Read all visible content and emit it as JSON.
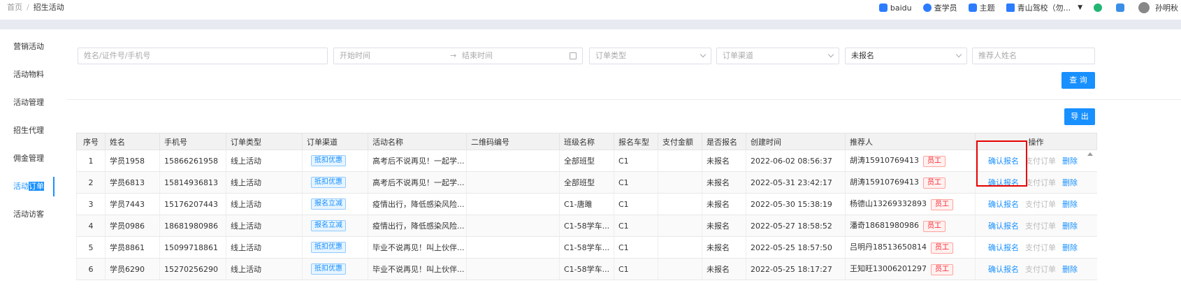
{
  "breadcrumb": {
    "home": "首页",
    "separator": "/",
    "current": "招生活动"
  },
  "topbar": {
    "items": [
      {
        "label": "baidu",
        "icon": "baidu-icon",
        "color": "#2b7cff"
      },
      {
        "label": "查学员",
        "icon": "search-student-icon",
        "color": "#2b7cff"
      },
      {
        "label": "主题",
        "icon": "shirt-icon",
        "color": "#2b7cff"
      },
      {
        "label": "青山驾校（勿...",
        "icon": "school-icon",
        "color": "#2b7cff"
      }
    ],
    "user": "孙明秋"
  },
  "sidebar": {
    "items": [
      {
        "label": "营销活动"
      },
      {
        "label": "活动物料"
      },
      {
        "label": "活动管理"
      },
      {
        "label": "招生代理"
      },
      {
        "label": "佣金管理"
      },
      {
        "label_a": "活动",
        "label_b": "订单",
        "active": true
      },
      {
        "label": "活动访客"
      }
    ]
  },
  "filters": {
    "keyword_placeholder": "姓名/证件号/手机号",
    "start_placeholder": "开始时间",
    "arrow": "→",
    "end_placeholder": "结束时间",
    "order_type_placeholder": "订单类型",
    "order_channel_placeholder": "订单渠道",
    "enroll_status_value": "未报名",
    "referrer_placeholder": "推荐人姓名"
  },
  "buttons": {
    "query": "查 询",
    "export": "导 出"
  },
  "table": {
    "headers": [
      "序号",
      "姓名",
      "手机号",
      "订单类型",
      "订单渠道",
      "活动名称",
      "二维码编号",
      "班级名称",
      "报名车型",
      "支付金额",
      "是否报名",
      "创建时间",
      "推荐人",
      "操作"
    ],
    "actions": [
      "确认报名",
      "支付订单",
      "删除"
    ],
    "staff_tag": "员工",
    "rows": [
      {
        "no": "1",
        "name": "学员1958",
        "phone": "15866261958",
        "type": "线上活动",
        "channel": "抵扣优惠",
        "activity": "高考后不说再见！一起学...",
        "qrcode": "",
        "class": "全部班型",
        "car": "C1",
        "amount": "",
        "enrolled": "未报名",
        "created": "2022-06-02 08:56:37",
        "referrer": "胡涛15910769413"
      },
      {
        "no": "2",
        "name": "学员6813",
        "phone": "15814936813",
        "type": "线上活动",
        "channel": "抵扣优惠",
        "activity": "高考后不说再见！一起学...",
        "qrcode": "",
        "class": "全部班型",
        "car": "C1",
        "amount": "",
        "enrolled": "未报名",
        "created": "2022-05-31 23:42:17",
        "referrer": "胡涛15910769413"
      },
      {
        "no": "3",
        "name": "学员7443",
        "phone": "15176207443",
        "type": "线上活动",
        "channel": "报名立减",
        "activity": "疫情出行，降低感染风险...",
        "qrcode": "",
        "class": "C1-唐雎",
        "car": "C1",
        "amount": "",
        "enrolled": "未报名",
        "created": "2022-05-30 15:38:19",
        "referrer": "杨德山13269332893"
      },
      {
        "no": "4",
        "name": "学员0986",
        "phone": "18681980986",
        "type": "线上活动",
        "channel": "报名立减",
        "activity": "疫情出行，降低感染风险...",
        "qrcode": "",
        "class": "C1-58学车...",
        "car": "C1",
        "amount": "",
        "enrolled": "未报名",
        "created": "2022-05-27 18:58:52",
        "referrer": "潘奇18681980986"
      },
      {
        "no": "5",
        "name": "学员8861",
        "phone": "15099718861",
        "type": "线上活动",
        "channel": "抵扣优惠",
        "activity": "毕业不说再见！叫上伙伴...",
        "qrcode": "",
        "class": "C1-58学车...",
        "car": "C1",
        "amount": "",
        "enrolled": "未报名",
        "created": "2022-05-25 18:57:50",
        "referrer": "吕明丹18513650814"
      },
      {
        "no": "6",
        "name": "学员6290",
        "phone": "15270256290",
        "type": "线上活动",
        "channel": "抵扣优惠",
        "activity": "毕业不说再见！叫上伙伴...",
        "qrcode": "",
        "class": "C1-58学车...",
        "car": "C1",
        "amount": "",
        "enrolled": "未报名",
        "created": "2022-05-25 18:17:27",
        "referrer": "王知旺13006201297"
      }
    ]
  },
  "colors": {
    "primary": "#1890ff",
    "highlight_box": "#e60000"
  }
}
